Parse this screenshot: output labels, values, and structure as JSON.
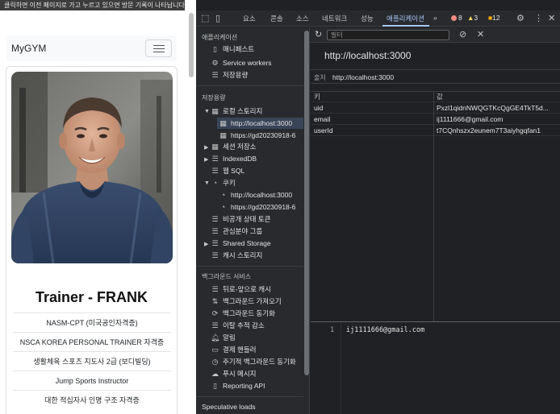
{
  "page": {
    "tooltip": "클릭하면 이전 페이지로 가고 누르고 있으면 방문 기록이 나타납니다.",
    "brand": "MyGYM",
    "trainer_name": "Trainer - FRANK",
    "certifications": [
      "NASM-CPT (미국공인자격증)",
      "NSCA KOREA PERSONAL TRAINER 자격증",
      "생활체육 스포츠 지도사 2급 (보디빌딩)",
      "Jump Sports Instructor",
      "대한 적십자사 인명 구조 자격증"
    ]
  },
  "devtools": {
    "tabs": [
      "요소",
      "콘솔",
      "소스",
      "네트워크",
      "성능",
      "애플리케이션"
    ],
    "active_tab": "애플리케이션",
    "more_tabs": "»",
    "badges": {
      "errors": "8",
      "warnings": "3",
      "issues": "12"
    },
    "sidebar": {
      "app_title": "애플리케이션",
      "app_items": [
        "매니페스트",
        "Service workers",
        "저장용량"
      ],
      "storage_title": "저장용량",
      "local_storage": "로컬 스토리지",
      "local_children": [
        "http://localhost:3000",
        "https://gd20230918-6"
      ],
      "session_storage": "세션 저장소",
      "indexeddb": "IndexedDB",
      "websql": "웹 SQL",
      "cookies": "쿠키",
      "cookie_children": [
        "http://localhost:3000",
        "https://gd20230918-6"
      ],
      "storage_more": [
        "비공개 상태 토큰",
        "관심분야 그룹",
        "Shared Storage",
        "캐시 스토리지"
      ],
      "bg_title": "백그라운드 서비스",
      "bg_items": [
        "뒤로-앞으로 캐시",
        "백그라운드 가져오기",
        "백그라운드 동기화",
        "이탈 추적 감소",
        "알림",
        "결제 핸들러",
        "주기적 백그라운드 동기화",
        "푸시 메시지",
        "Reporting API"
      ],
      "spec_title": "Speculative loads"
    },
    "main": {
      "filter_placeholder": "필터",
      "origin_header": "http://localhost:3000",
      "origin_label": "출처",
      "origin_value": "http://localhost:3000",
      "columns": {
        "key": "키",
        "value": "값"
      },
      "rows": [
        {
          "key": "uid",
          "value": "Pxzl1qidnNWQGTKcQgGE4TkT5d..."
        },
        {
          "key": "email",
          "value": "ij1111666@gmail.com"
        },
        {
          "key": "userId",
          "value": "t7CQnhszx2eunem7T3aiyhgqfan1"
        }
      ],
      "preview_line": "1",
      "preview_value": "ij1111666@gmail.com"
    }
  }
}
